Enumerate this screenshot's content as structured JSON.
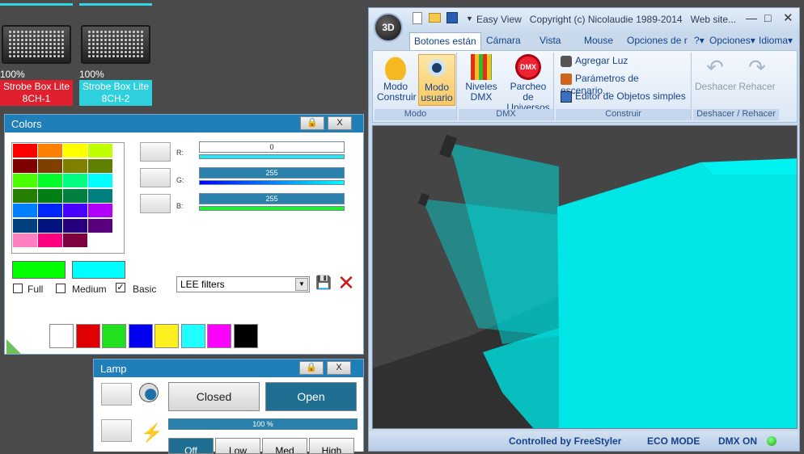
{
  "fixtures": [
    {
      "percent": "100%",
      "name": "Strobe Box Lite",
      "channel": "8CH-1",
      "label_color": "#e0202e"
    },
    {
      "percent": "100%",
      "name": "Strobe Box Lite",
      "channel": "8CH-2",
      "label_color": "#2fd0de"
    }
  ],
  "colors_panel": {
    "title": "Colors",
    "lock_icon": "lock-icon",
    "close_label": "X",
    "rgb": [
      {
        "label": "R:",
        "value": "0"
      },
      {
        "label": "G:",
        "value": "255"
      },
      {
        "label": "B:",
        "value": "255"
      }
    ],
    "checkboxes": [
      {
        "label": "Full",
        "checked": false
      },
      {
        "label": "Medium",
        "checked": false
      },
      {
        "label": "Basic",
        "checked": true
      }
    ],
    "filter_dropdown": "LEE filters",
    "accent": "#1f7fb8",
    "current_color": "#00ff00",
    "selected_color": "#00ffff",
    "swatches": [
      "#ff0000",
      "#ff7f00",
      "#ffff00",
      "#bfff00",
      "#7f0000",
      "#7f3f00",
      "#7f7f00",
      "#5f7f00",
      "#4cff00",
      "#00ff2a",
      "#00ff80",
      "#00ffff",
      "#267f00",
      "#007f15",
      "#007f40",
      "#007f7f",
      "#0080ff",
      "#0026ff",
      "#4800ff",
      "#b200ff",
      "#00407f",
      "#00137f",
      "#24007f",
      "#59007f",
      "#ff80c0",
      "#ff0080",
      "#7f0040",
      "#ffffff"
    ],
    "basic_colors": [
      "#ffffff",
      "#e00000",
      "#20e020",
      "#0000ee",
      "#ffee20",
      "#20ffff",
      "#ff00ff",
      "#000000"
    ]
  },
  "lamp_panel": {
    "title": "Lamp",
    "close_label": "X",
    "closed_label": "Closed",
    "open_label": "Open",
    "progress_label": "100 %",
    "progress": 1.0,
    "modes": [
      "Off",
      "Low",
      "Med",
      "High"
    ]
  },
  "easyview": {
    "title": "Easy View   Copyright (c) Nicolaudie 1989-2014   Web site...",
    "orb_label": "3D",
    "tabs": [
      "Botones están",
      "Cámara",
      "Vista",
      "Mouse",
      "Opciones de r"
    ],
    "right_tabs": [
      "?",
      "Opciones",
      "Idioma"
    ],
    "groups": {
      "modo": {
        "name": "Modo",
        "buttons": [
          {
            "line1": "Modo",
            "line2": "Construir"
          },
          {
            "line1": "Modo",
            "line2": "usuario"
          }
        ]
      },
      "dmx": {
        "name": "DMX",
        "buttons": [
          {
            "line1": "Niveles",
            "line2": "DMX"
          },
          {
            "line1": "Parcheo de",
            "line2": "Universos"
          }
        ]
      },
      "construir": {
        "name": "Construir",
        "items": [
          "Agregar Luz",
          "Parámetros de escenario...",
          "Editor de Objetos simples"
        ]
      },
      "undo": {
        "name": "Deshacer / Rehacer",
        "buttons": [
          "Deshacer",
          "Rehacer"
        ]
      }
    },
    "status": [
      "Controlled by FreeStyler",
      "ECO MODE",
      "DMX ON"
    ],
    "beam_color": "#00e5e5"
  }
}
